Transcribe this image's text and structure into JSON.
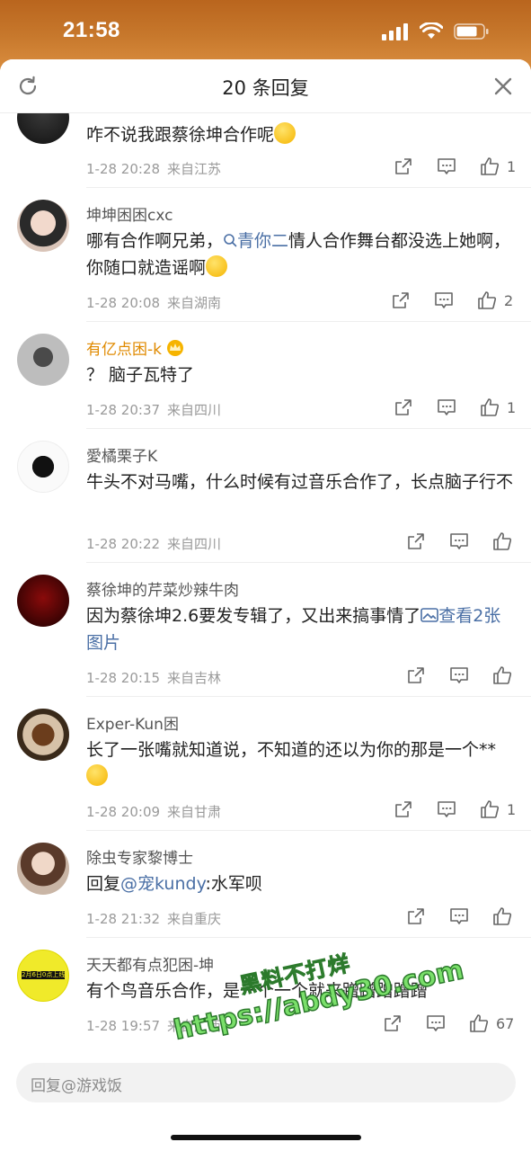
{
  "status_bar": {
    "time": "21:58"
  },
  "header": {
    "title": "20 条回复"
  },
  "comments": [
    {
      "username": "",
      "text": "咋不说我跟蔡徐坤合作呢",
      "emoji": "laugh-cry",
      "date": "1-28 20:28",
      "location": "来自江苏",
      "likes": "1"
    },
    {
      "username": "坤坤困困cxc",
      "text_before": "哪有合作啊兄弟，",
      "link": "青你二",
      "text_after": "情人合作舞台都没选上她啊，你随口就造谣啊",
      "emoji": "smile-hands",
      "date": "1-28 20:08",
      "location": "来自湖南",
      "likes": "2"
    },
    {
      "username": "有亿点困-k",
      "text": "？ 脑子瓦特了",
      "date": "1-28 20:37",
      "location": "来自四川",
      "likes": "1"
    },
    {
      "username": "愛橘栗子K",
      "text": "牛头不对马嘴，什么时候有过音乐合作了，长点脑子行不",
      "date": "1-28 20:22",
      "location": "来自四川",
      "likes": ""
    },
    {
      "username": "蔡徐坤的芹菜炒辣牛肉",
      "text": "因为蔡徐坤2.6要发专辑了，又出来搞事情了",
      "link": "查看2张图片",
      "date": "1-28 20:15",
      "location": "来自吉林",
      "likes": ""
    },
    {
      "username": "Exper-Kun困",
      "text": "长了一张嘴就知道说，不知道的还以为你的那是一个**",
      "emoji": "thinking",
      "date": "1-28 20:09",
      "location": "来自甘肃",
      "likes": "1"
    },
    {
      "username": "除虫专家黎博士",
      "text_before": "回复",
      "link": "@宠kundy",
      "text_after": ":水军呗",
      "date": "1-28 21:32",
      "location": "来自重庆",
      "likes": ""
    },
    {
      "username": "天天都有点犯困-坤",
      "text": "有个鸟音乐合作，是一个一个就来蹭蹭蹭蹭蹭",
      "avatar_text": "2月6日0点上线",
      "date": "1-28 19:57",
      "location": "来自广西",
      "likes": "67"
    }
  ],
  "reply_bar": {
    "placeholder": "回复@游戏饭"
  },
  "watermark": {
    "line1": "黑料不打烊",
    "line2": "https://abdy30.com"
  }
}
